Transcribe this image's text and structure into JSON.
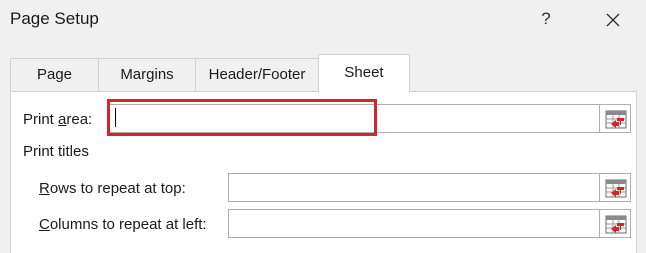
{
  "dialog": {
    "title": "Page Setup",
    "help_label": "?"
  },
  "tabs": [
    {
      "label": "Page",
      "active": false
    },
    {
      "label": "Margins",
      "active": false
    },
    {
      "label": "Header/Footer",
      "active": false
    },
    {
      "label": "Sheet",
      "active": true
    }
  ],
  "sheet": {
    "print_area": {
      "label_pre": "Print ",
      "label_accel": "a",
      "label_post": "rea:",
      "value": ""
    },
    "print_titles_label": "Print titles",
    "rows_repeat": {
      "label_accel": "R",
      "label_post": "ows to repeat at top:",
      "value": ""
    },
    "cols_repeat": {
      "label_accel": "C",
      "label_post": "olumns to repeat at left:",
      "value": ""
    }
  },
  "colors": {
    "highlight": "#d9232a"
  }
}
